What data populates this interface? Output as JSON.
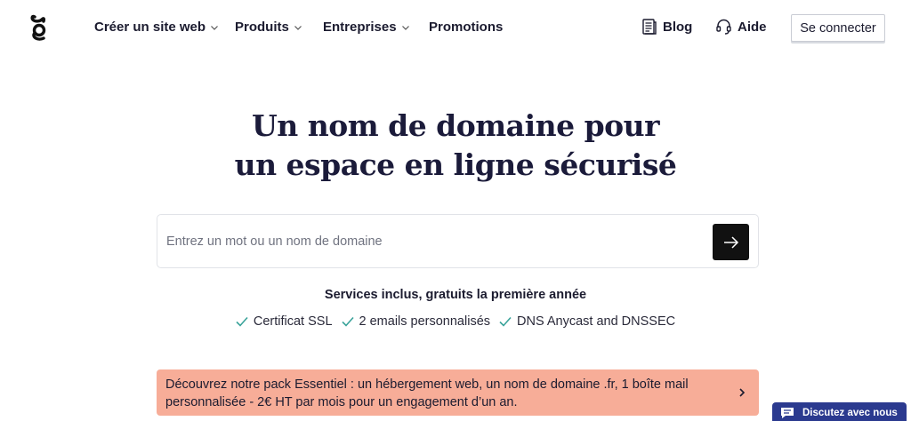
{
  "header": {
    "logo_icon": "gandi-logo-icon",
    "nav": [
      {
        "label": "Créer un site web",
        "icon": "chevron-down-icon"
      },
      {
        "label": "Produits",
        "icon": "chevron-down-icon"
      },
      {
        "label": "Entreprises",
        "icon": "chevron-down-icon"
      },
      {
        "label": "Promotions"
      }
    ],
    "blog": {
      "label": "Blog",
      "icon": "blog-icon"
    },
    "help": {
      "label": "Aide",
      "icon": "headset-icon"
    },
    "login_label": "Se connecter"
  },
  "hero": {
    "title_line1": "Un nom de domaine pour",
    "title_line2": "un espace en ligne sécurisé"
  },
  "search": {
    "placeholder": "Entrez un mot ou un nom de domaine",
    "value": "",
    "submit_icon": "arrow-right-icon"
  },
  "services": {
    "title": "Services inclus, gratuits la première année",
    "items": [
      "Certificat SSL",
      "2 emails personnalisés",
      "DNS Anycast and DNSSEC"
    ],
    "check_color": "#3aa39a"
  },
  "promo": {
    "text": "Découvrez notre pack Essentiel : un hébergement web, un nom de domaine .fr, 1 boîte mail personnalisée - 2€ HT par mois pour un engagement d’un an.",
    "background": "#f7ad98",
    "icon": "chevron-right-icon"
  },
  "chat": {
    "label": "Discutez avec nous",
    "icon": "chat-bubble-icon",
    "background": "#2b3a8f"
  }
}
